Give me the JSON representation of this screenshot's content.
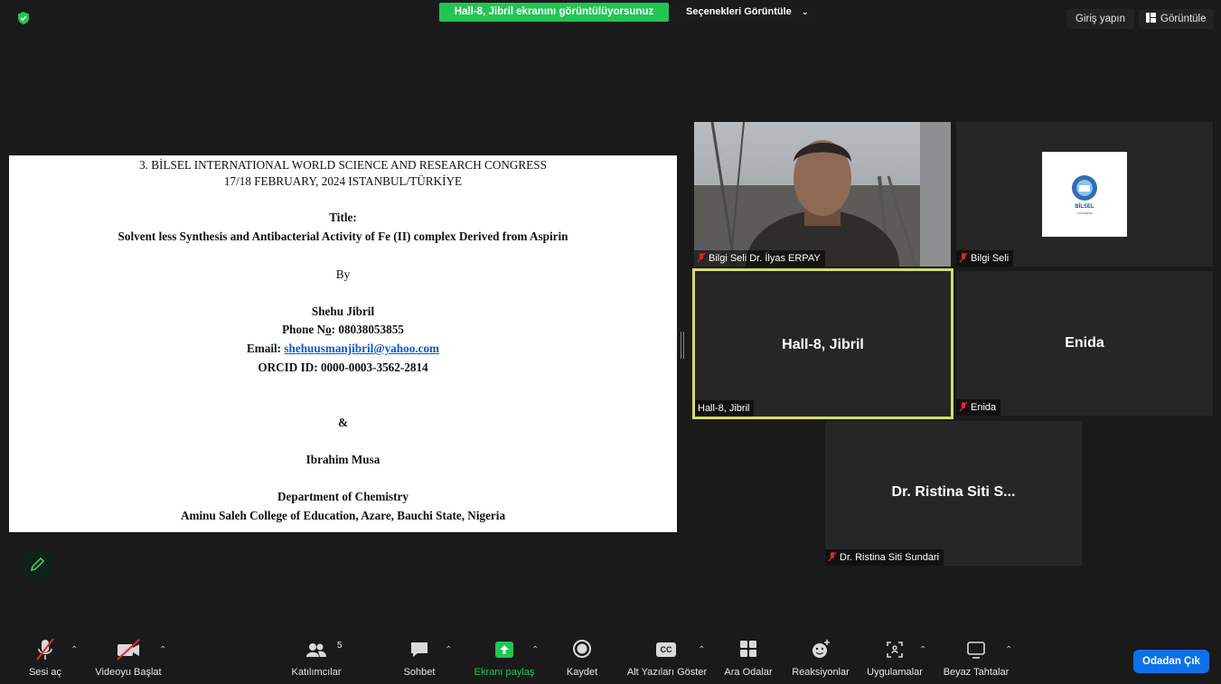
{
  "top": {
    "share_banner": "Hall-8, Jibril ekranını görüntülüyorsunuz",
    "view_options": "Seçenekleri Görüntüle",
    "sign_in": "Giriş yapın",
    "view": "Görüntüle"
  },
  "document": {
    "line1": "3. BİLSEL INTERNATIONAL WORLD SCIENCE AND RESEARCH CONGRESS",
    "line2": "17/18 FEBRUARY, 2024 ISTANBUL/TÜRKİYE",
    "title_label": "Title:",
    "title": "Solvent less Synthesis and Antibacterial Activity of Fe (II) complex Derived from Aspirin",
    "by": "By",
    "author1": "Shehu Jibril",
    "phone_label": "Phone N",
    "phone_o": "o",
    "phone_value": ": 08038053855",
    "email_label": "Email: ",
    "email": "shehuusmanjibril@yahoo.com",
    "orcid": "ORCID ID: 0000-0003-3562-2814",
    "ampersand": "&",
    "author2": "Ibrahim Musa",
    "department": "Department of Chemistry",
    "institution": "Aminu Saleh College of Education, Azare, Bauchi State, Nigeria"
  },
  "participants": [
    {
      "name": "Bilgi Seli Dr. İlyas ERPAY",
      "muted": true
    },
    {
      "name": "Bilgi Seli",
      "muted": true,
      "logo_text": "BİLSEL"
    },
    {
      "name": "Hall-8, Jibril",
      "display": "Hall-8, Jibril",
      "muted": false,
      "active_speaker": true
    },
    {
      "name": "Enida",
      "display": "Enida",
      "muted": true
    },
    {
      "name": "Dr. Ristina Siti Sundari",
      "display": "Dr. Ristina Siti S...",
      "muted": true
    }
  ],
  "toolbar": {
    "mute": "Sesi aç",
    "video": "Videoyu Başlat",
    "participants": "Katılımcılar",
    "participants_count": "5",
    "chat": "Sohbet",
    "share": "Ekranı paylaş",
    "record": "Kaydet",
    "captions": "Alt Yazıları Göster",
    "captions_icon_text": "CC",
    "breakout": "Ara Odalar",
    "reactions": "Reaksiyonlar",
    "apps": "Uygulamalar",
    "whiteboard": "Beyaz Tahtalar",
    "leave": "Odadan Çık"
  },
  "colors": {
    "share_green": "#23c552",
    "leave_blue": "#0e71eb",
    "active_border": "#d3dd6e",
    "muted_red": "#e02828"
  }
}
